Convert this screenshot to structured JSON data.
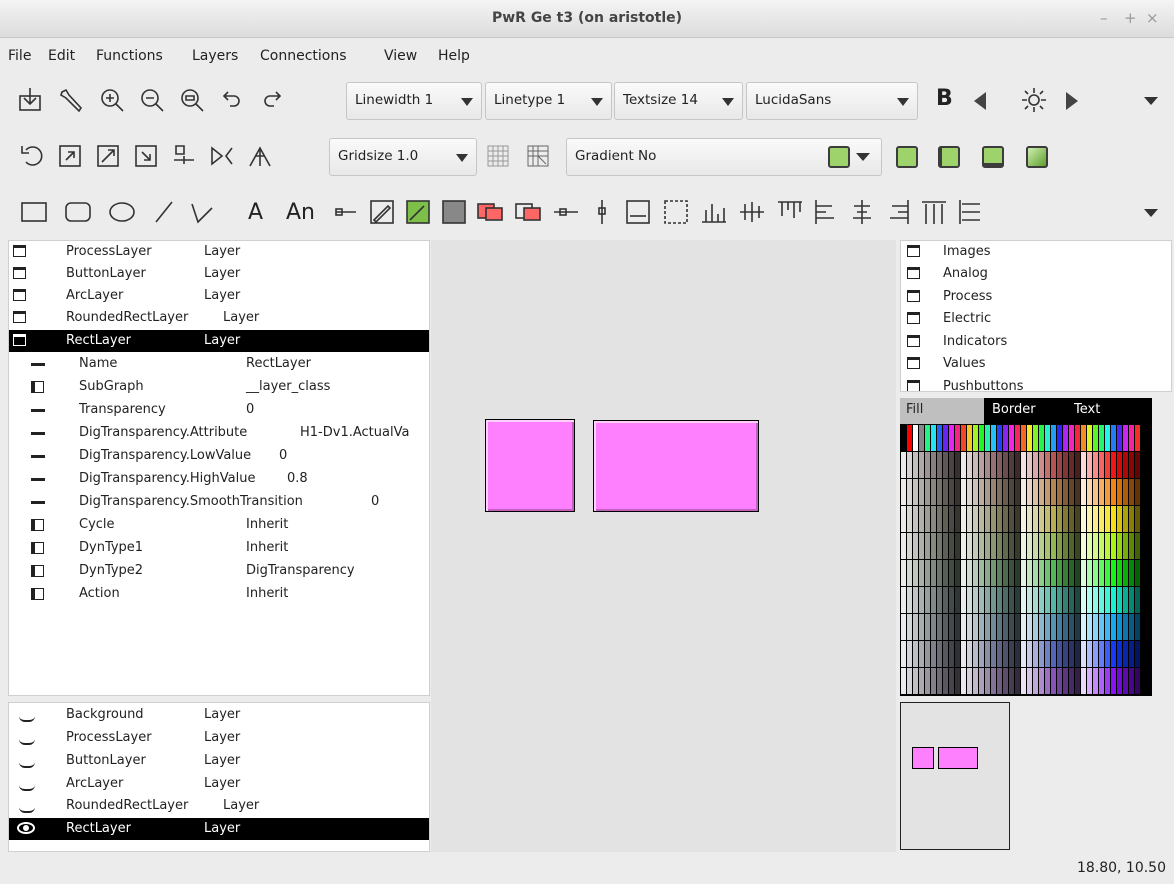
{
  "window": {
    "title": "PwR Ge   t3 (on aristotle)",
    "controls": [
      "–",
      "+",
      "×"
    ]
  },
  "menu": [
    "File",
    "Edit",
    "Functions",
    "Layers",
    "Connections",
    "View",
    "Help"
  ],
  "toolbar": {
    "linewidth": "Linewidth 1",
    "linetype": "Linetype 1",
    "textsize": "Textsize 14",
    "font": "LucidaSans",
    "bold": "B",
    "gridsize": "Gridsize 1.0",
    "gradient": "Gradient No",
    "text_tool": "A",
    "annot_tool": "An"
  },
  "icons": [
    "import-icon",
    "wrench-icon",
    "zoom-in-icon",
    "zoom-out-icon",
    "zoom-reset-icon",
    "undo-icon",
    "redo-icon"
  ],
  "layers_top": [
    {
      "name": "ProcessLayer",
      "type": "Layer"
    },
    {
      "name": "ButtonLayer",
      "type": "Layer"
    },
    {
      "name": "ArcLayer",
      "type": "Layer"
    },
    {
      "name": "RoundedRectLayer",
      "type": "Layer"
    },
    {
      "name": "RectLayer",
      "type": "Layer"
    }
  ],
  "attributes": [
    {
      "icon": "dash",
      "name": "Name",
      "value": "RectLayer"
    },
    {
      "icon": "book",
      "name": "SubGraph",
      "value": "__layer_class"
    },
    {
      "icon": "dash",
      "name": "Transparency",
      "value": "0"
    },
    {
      "icon": "dash",
      "name": "DigTransparency.Attribute",
      "value": "H1-Dv1.ActualVa"
    },
    {
      "icon": "dash",
      "name": "DigTransparency.LowValue",
      "value": "0"
    },
    {
      "icon": "dash",
      "name": "DigTransparency.HighValue",
      "value": "0.8"
    },
    {
      "icon": "dash",
      "name": "DigTransparency.SmoothTransition",
      "value": "0"
    },
    {
      "icon": "book",
      "name": "Cycle",
      "value": "Inherit"
    },
    {
      "icon": "book",
      "name": "DynType1",
      "value": "Inherit"
    },
    {
      "icon": "book",
      "name": "DynType2",
      "value": "DigTransparency"
    },
    {
      "icon": "book",
      "name": "Action",
      "value": "Inherit"
    }
  ],
  "layers_bottom": [
    {
      "name": "Background",
      "type": "Layer"
    },
    {
      "name": "ProcessLayer",
      "type": "Layer"
    },
    {
      "name": "ButtonLayer",
      "type": "Layer"
    },
    {
      "name": "ArcLayer",
      "type": "Layer"
    },
    {
      "name": "RoundedRectLayer",
      "type": "Layer"
    },
    {
      "name": "RectLayer",
      "type": "Layer"
    }
  ],
  "subgraphs": [
    "Images",
    "Analog",
    "Process",
    "Electric",
    "Indicators",
    "Values",
    "Pushbuttons"
  ],
  "palette_tabs": [
    "Fill",
    "Border",
    "Text"
  ],
  "status": {
    "coords": "18.80, 10.50"
  },
  "colors": {
    "rect_fill": "#ff80ff",
    "gradient_fill": "#9ed36c",
    "canvas": "#e3e3e3"
  }
}
